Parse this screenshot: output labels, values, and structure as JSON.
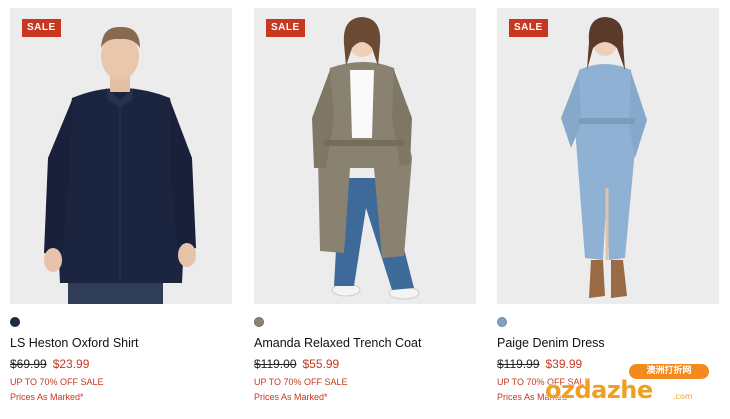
{
  "products": [
    {
      "badge": "SALE",
      "name": "LS Heston Oxford Shirt",
      "was_price": "$69.99",
      "now_price": "$23.99",
      "promo": "UP TO 70% OFF SALE",
      "prices_note": "Prices As Marked*",
      "swatch_color": "#1f2a44"
    },
    {
      "badge": "SALE",
      "name": "Amanda Relaxed Trench Coat",
      "was_price": "$119.00",
      "now_price": "$55.99",
      "promo": "UP TO 70% OFF SALE",
      "prices_note": "Prices As Marked*",
      "swatch_color": "#8a8272"
    },
    {
      "badge": "SALE",
      "name": "Paige Denim Dress",
      "was_price": "$119.99",
      "now_price": "$39.99",
      "promo": "UP TO 70% OFF SALE",
      "prices_note": "Prices As Marked*",
      "swatch_color": "#7fa3c2"
    }
  ],
  "watermark": {
    "banner": "澳洲打折网",
    "text": "ozdazhe",
    "suffix": ".com"
  },
  "colors": {
    "sale_red": "#c8371f",
    "image_bg": "#ececed",
    "watermark_orange": "#f0a020"
  }
}
